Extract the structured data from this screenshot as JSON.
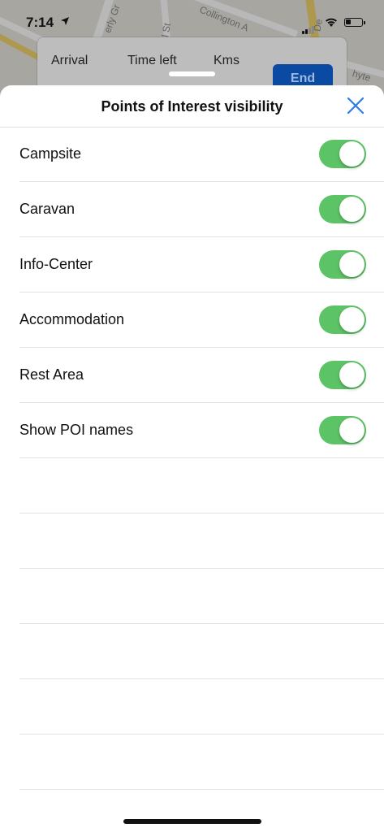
{
  "status_bar": {
    "time": "7:14",
    "icons": [
      "location-arrow-icon",
      "cellular-signal-icon",
      "wifi-icon",
      "battery-icon"
    ]
  },
  "map": {
    "street_labels": [
      "erly Gr",
      "l St",
      "Collington A",
      "De",
      "hyte"
    ]
  },
  "navigation_card": {
    "arrival_label": "Arrival",
    "time_left_label": "Time left",
    "kms_label": "Kms",
    "end_button_label": "End"
  },
  "sheet": {
    "title": "Points of Interest visibility",
    "close_icon": "close-icon",
    "items": [
      {
        "label": "Campsite",
        "enabled": true
      },
      {
        "label": "Caravan",
        "enabled": true
      },
      {
        "label": "Info-Center",
        "enabled": true
      },
      {
        "label": "Accommodation",
        "enabled": true
      },
      {
        "label": "Rest Area",
        "enabled": true
      },
      {
        "label": "Show POI names",
        "enabled": true
      }
    ]
  },
  "colors": {
    "toggle_on": "#5cc466",
    "close_icon": "#2f7de1",
    "end_button": "#0b4aa2"
  }
}
